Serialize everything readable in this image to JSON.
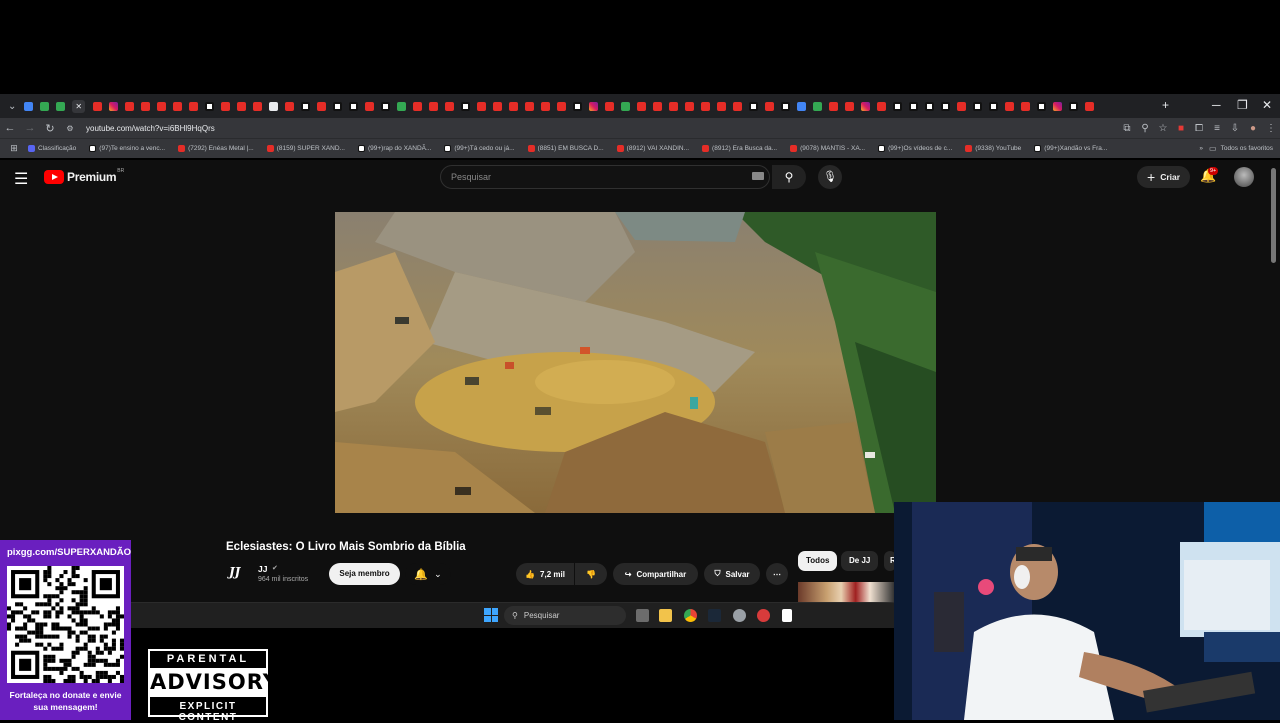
{
  "browser": {
    "url": "youtube.com/watch?v=i6BHl9HqQrs",
    "bookmarks": [
      {
        "icon": "discord",
        "label": "Classificação"
      },
      {
        "icon": "tiktok",
        "label": "(97)Te ensino a venc..."
      },
      {
        "icon": "youtube",
        "label": "(7292) Enéas Metal |..."
      },
      {
        "icon": "youtube",
        "label": "(8159) SUPER XAND..."
      },
      {
        "icon": "tiktok",
        "label": "(99+)rap do XANDÃ..."
      },
      {
        "icon": "tiktok",
        "label": "(99+)Tá cedo ou já..."
      },
      {
        "icon": "youtube",
        "label": "(8851) EM BUSCA D..."
      },
      {
        "icon": "youtube",
        "label": "(8912) VAI XANDIN..."
      },
      {
        "icon": "youtube",
        "label": "(8912) Era Busca da..."
      },
      {
        "icon": "youtube",
        "label": "(9078) MANTIS - XA..."
      },
      {
        "icon": "tiktok",
        "label": "(99+)Os vídeos de c..."
      },
      {
        "icon": "youtube",
        "label": "(9338) YouTube"
      },
      {
        "icon": "tiktok",
        "label": "(99+)Xandão vs Fra..."
      }
    ],
    "all_bookmarks": "Todos os favoritos",
    "tabs": [
      "dropdown",
      "bl",
      "gr",
      "gr",
      "close",
      "yt",
      "ig",
      "yt",
      "yt",
      "yt",
      "yt",
      "yt",
      "tk",
      "yt",
      "yt",
      "yt",
      "wh",
      "yt",
      "tk",
      "yt",
      "tk",
      "tk",
      "yt",
      "tk",
      "gr",
      "yt",
      "yt",
      "yt",
      "tk",
      "yt",
      "yt",
      "yt",
      "yt",
      "yt",
      "yt",
      "tk",
      "ig",
      "yt",
      "gr",
      "yt",
      "yt",
      "yt",
      "yt",
      "yt",
      "yt",
      "yt",
      "tk",
      "yt",
      "tk",
      "bl",
      "gr",
      "yt",
      "yt",
      "ig",
      "yt",
      "tk",
      "tk",
      "tk",
      "tk",
      "yt",
      "tk",
      "tk",
      "yt",
      "yt",
      "tk",
      "ig",
      "tk",
      "yt"
    ]
  },
  "youtube": {
    "logo_text": "Premium",
    "region": "BR",
    "search_placeholder": "Pesquisar",
    "create_label": "Criar",
    "notifications": "9+",
    "video": {
      "title": "Eclesiastes: O Livro Mais Sombrio da Bíblia",
      "channel": "JJ",
      "channel_logo": "JJ",
      "subscribers": "964 mil inscritos",
      "join_label": "Seja membro",
      "likes": "7,2 mil",
      "share_label": "Compartilhar",
      "save_label": "Salvar"
    },
    "chips": [
      "Todos",
      "De JJ",
      "R"
    ]
  },
  "taskbar": {
    "search_placeholder": "Pesquisar"
  },
  "overlay": {
    "qr_title": "pixgg.com/SUPERXANDÃO",
    "qr_caption": "Fortaleça no donate e envie sua mensagem!",
    "advisory_top": "PARENTAL",
    "advisory_mid": "ADVISORY",
    "advisory_bot": "EXPLICIT CONTENT"
  },
  "colors": {
    "yt_red": "#ff0000",
    "qr_panel": "#6a1fbf",
    "dark_bg": "#0f0f0f"
  }
}
